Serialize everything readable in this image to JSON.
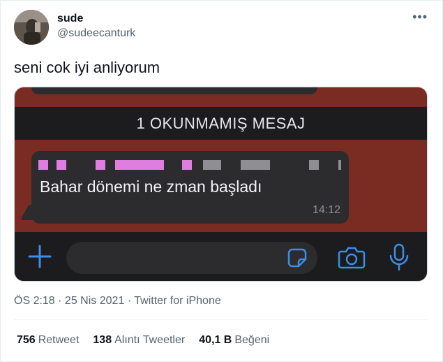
{
  "tweet": {
    "display_name": "sude",
    "handle": "@sudeecanturk",
    "more_icon": "more-dots-icon",
    "text": "seni cok iyi anliyorum",
    "meta": "ÖS 2:18 · 25 Nis 2021 · Twitter for iPhone"
  },
  "screenshot": {
    "unread_banner": "1 OKUNMAMIŞ MESAJ",
    "message_text": "Bahar dönemi ne zman başladı",
    "message_time": "14:12",
    "colors": {
      "chat_background": "#7a2c22",
      "bar_background": "#1c1c1e",
      "bubble": "#2c2c2e",
      "accent": "#3d8ee6",
      "censor_pink": "#e07ee0",
      "censor_gray": "#8e8e93"
    },
    "icons": [
      "plus-icon",
      "sticker-icon",
      "camera-icon",
      "microphone-icon"
    ]
  },
  "stats": {
    "retweets": {
      "count": "756",
      "label": "Retweet"
    },
    "quotes": {
      "count": "138",
      "label": "Alıntı Tweetler"
    },
    "likes": {
      "count": "40,1 B",
      "label": "Beğeni"
    }
  }
}
